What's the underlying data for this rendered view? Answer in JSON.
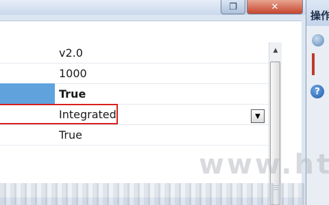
{
  "window": {
    "restore_glyph": "❐",
    "close_glyph": "✕"
  },
  "property_rows": [
    {
      "value": "v2.0"
    },
    {
      "value": "1000"
    },
    {
      "value": "True",
      "selected": true
    },
    {
      "value": "Integrated"
    },
    {
      "value": "True"
    }
  ],
  "dropdown": {
    "glyph": "▼"
  },
  "scrollbar": {
    "up_glyph": "▲"
  },
  "right_panel": {
    "title": "操作",
    "help_glyph": "?"
  },
  "watermark": {
    "text": "www.ht"
  },
  "colors": {
    "selection": "#5fa2dc",
    "highlight_border": "#d81e1e",
    "close_button": "#c5452f"
  }
}
